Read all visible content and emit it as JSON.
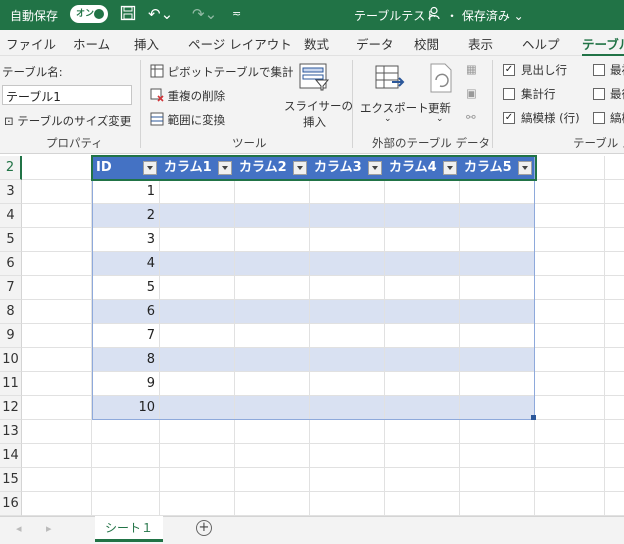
{
  "titlebar": {
    "autosave_label": "自動保存",
    "toggle_label": "オン",
    "doc_title": "テーブルテスト",
    "save_status": "・ 保存済み ⌄",
    "colors": {
      "bg": "#217346"
    }
  },
  "ribbon_tabs": [
    "ファイル",
    "ホーム",
    "挿入",
    "ページ レイアウト",
    "数式",
    "データ",
    "校閲",
    "表示",
    "ヘルプ",
    "テーブル"
  ],
  "ribbon": {
    "properties": {
      "table_name_label": "テーブル名:",
      "table_name_value": "テーブル1",
      "resize_label": "テーブルのサイズ変更",
      "group_label": "プロパティ"
    },
    "tools": {
      "pivot_label": "ピボットテーブルで集計",
      "remove_dup_label": "重複の削除",
      "convert_label": "範囲に変換",
      "slicer_label_1": "スライサーの",
      "slicer_label_2": "挿入",
      "group_label": "ツール"
    },
    "external": {
      "export_label": "エクスポート",
      "refresh_label": "更新",
      "group_label": "外部のテーブル データ"
    },
    "style_options": {
      "header_row": "見出し行",
      "total_row": "集計行",
      "banded_rows": "縞模様 (行)",
      "first_col": "最初",
      "last_col": "最後",
      "banded_cols": "縞模",
      "group_label": "テーブル スタ"
    }
  },
  "sheet": {
    "row_numbers": [
      "2",
      "3",
      "4",
      "5",
      "6",
      "7",
      "8",
      "9",
      "10",
      "11",
      "12",
      "13",
      "14",
      "15",
      "16"
    ],
    "headers": [
      "ID",
      "カラム1",
      "カラム2",
      "カラム3",
      "カラム4",
      "カラム5"
    ],
    "ids": [
      "1",
      "2",
      "3",
      "4",
      "5",
      "6",
      "7",
      "8",
      "9",
      "10"
    ],
    "tab_name": "シート１",
    "colors": {
      "header": "#4472c4",
      "band": "#d9e1f2"
    }
  }
}
